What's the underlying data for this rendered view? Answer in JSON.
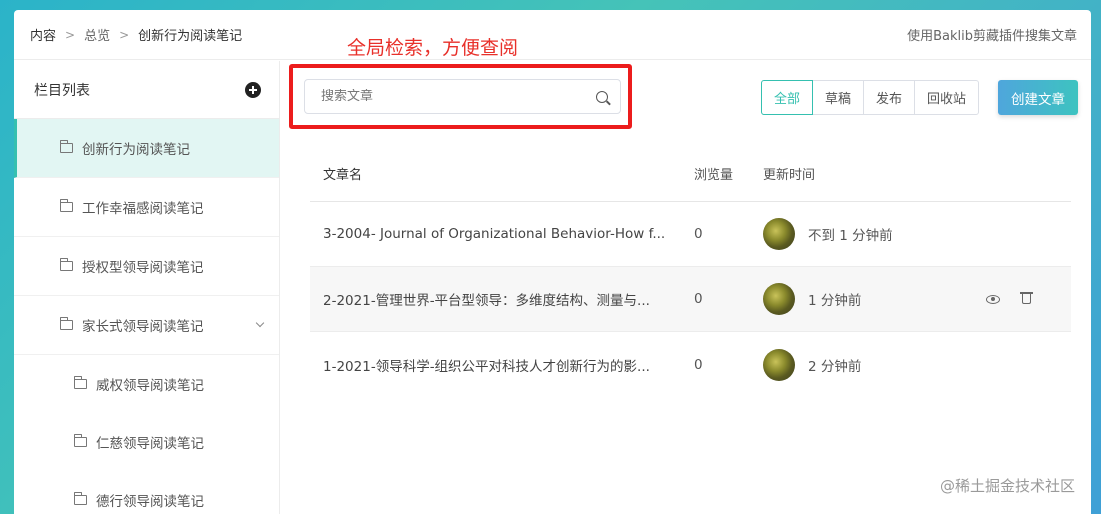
{
  "breadcrumb": {
    "items": [
      "内容",
      "总览",
      "创新行为阅读笔记"
    ],
    "separator": ">"
  },
  "header": {
    "link": "使用Baklib剪藏插件搜集文章"
  },
  "sidebar": {
    "title": "栏目列表",
    "items": [
      {
        "label": "创新行为阅读笔记"
      },
      {
        "label": "工作幸福感阅读笔记"
      },
      {
        "label": "授权型领导阅读笔记"
      },
      {
        "label": "家长式领导阅读笔记"
      },
      {
        "label": "威权领导阅读笔记"
      },
      {
        "label": "仁慈领导阅读笔记"
      },
      {
        "label": "德行领导阅读笔记"
      }
    ]
  },
  "annotation": {
    "text": "全局检索，方便查阅",
    "color": "#e8302a"
  },
  "search": {
    "placeholder": "搜索文章",
    "value": ""
  },
  "filters": {
    "all": "全部",
    "draft": "草稿",
    "published": "发布",
    "trash": "回收站"
  },
  "create_button": "创建文章",
  "table": {
    "headers": {
      "name": "文章名",
      "views": "浏览量",
      "updated": "更新时间"
    },
    "rows": [
      {
        "name": "3-2004- Journal of Organizational Behavior-How f...",
        "views": "0",
        "updated": "不到 1 分钟前"
      },
      {
        "name": "2-2021-管理世界-平台型领导：多维度结构、测量与...",
        "views": "0",
        "updated": "1 分钟前"
      },
      {
        "name": "1-2021-领导科学-组织公平对科技人才创新行为的影...",
        "views": "0",
        "updated": "2 分钟前"
      }
    ]
  },
  "watermark": "@稀土掘金技术社区",
  "colors": {
    "accent": "#35c0b0",
    "active_bg": "#e2f6f3",
    "highlight_frame": "#ec1c1c"
  }
}
